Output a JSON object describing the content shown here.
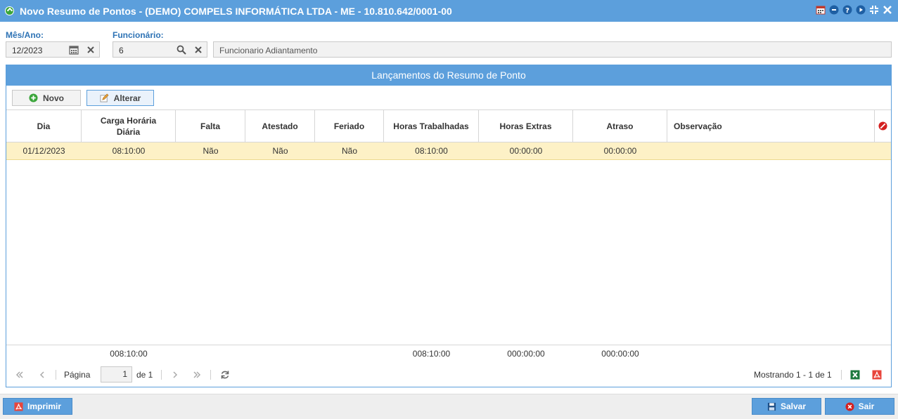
{
  "window": {
    "title": "Novo Resumo de Pontos - (DEMO) COMPELS INFORMÁTICA LTDA - ME - 10.810.642/0001-00",
    "controls": [
      "calendar-icon",
      "minimize-icon",
      "help-icon",
      "play-icon",
      "compress-icon",
      "close-icon"
    ]
  },
  "filters": {
    "mes_ano_label": "Mês/Ano:",
    "mes_ano_value": "12/2023",
    "funcionario_label": "Funcionário:",
    "funcionario_value": "6",
    "funcionario_name": "Funcionario Adiantamento"
  },
  "panel": {
    "title": "Lançamentos do Resumo de Ponto",
    "toolbar": {
      "novo": "Novo",
      "alterar": "Alterar"
    }
  },
  "grid": {
    "columns": [
      "Dia",
      "Carga Horária Diária",
      "Falta",
      "Atestado",
      "Feriado",
      "Horas Trabalhadas",
      "Horas Extras",
      "Atraso",
      "Observação"
    ],
    "rows": [
      [
        "01/12/2023",
        "08:10:00",
        "Não",
        "Não",
        "Não",
        "08:10:00",
        "00:00:00",
        "00:00:00",
        ""
      ]
    ],
    "totals": {
      "carga": "008:10:00",
      "horas_trabalhadas": "008:10:00",
      "horas_extras": "000:00:00",
      "atraso": "000:00:00"
    }
  },
  "pager": {
    "page_label": "Página",
    "page": "1",
    "of_label": "de 1",
    "showing": "Mostrando 1 - 1 de 1"
  },
  "footer": {
    "imprimir": "Imprimir",
    "salvar": "Salvar",
    "sair": "Sair"
  },
  "colors": {
    "accent": "#5c9fdc",
    "selected_row": "#fdf1c6",
    "label": "#2e73b5"
  }
}
